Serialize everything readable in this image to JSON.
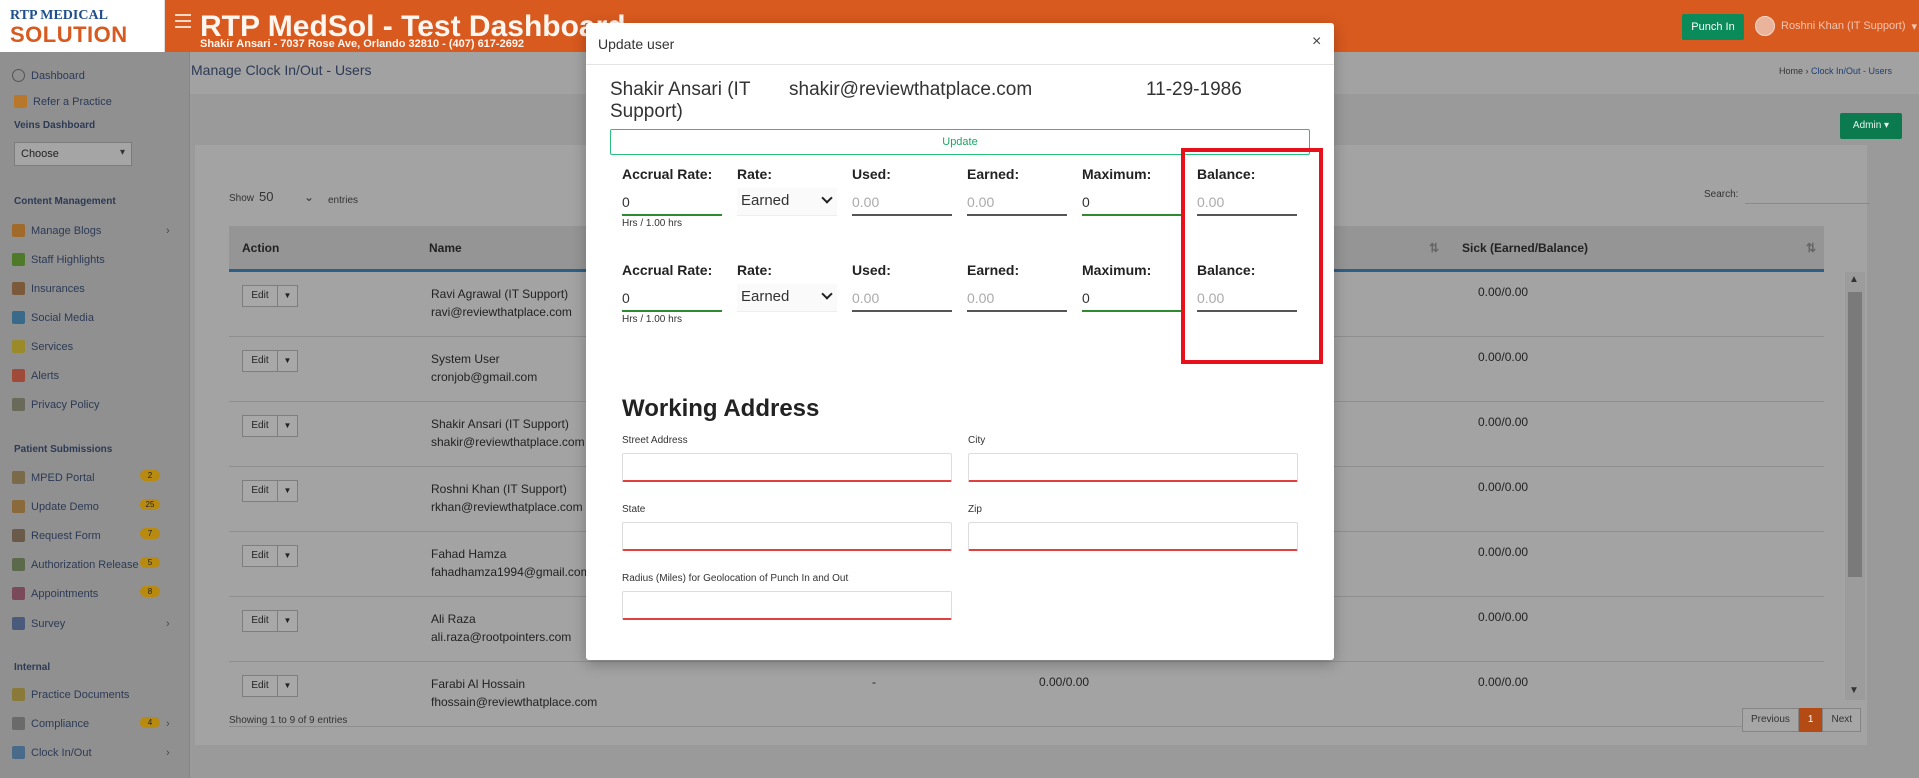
{
  "topbar": {
    "logo_line1": "RTP MEDICAL",
    "logo_line2": "SOLUTION",
    "title": "RTP MedSol - Test Dashboard",
    "subtitle": "Shakir Ansari - 7037 Rose Ave, Orlando 32810 - (407) 617-2692",
    "punch_in": "Punch In",
    "user": "Roshni Khan (IT Support)"
  },
  "sidebar": {
    "dashboard": "Dashboard",
    "refer": "Refer a Practice",
    "veins_dashboard": "Veins Dashboard",
    "choose": "Choose",
    "content_management": "Content Management",
    "manage_blogs": "Manage Blogs",
    "staff_highlights": "Staff Highlights",
    "insurances": "Insurances",
    "social_media": "Social Media",
    "services": "Services",
    "alerts": "Alerts",
    "privacy_policy": "Privacy Policy",
    "patient_submissions": "Patient Submissions",
    "mped_portal": "MPED Portal",
    "mped_badge": "2",
    "update_demo": "Update Demo",
    "update_demo_badge": "25",
    "request_form": "Request Form",
    "request_form_badge": "7",
    "auth_release": "Authorization Release",
    "auth_release_badge": "5",
    "appointments": "Appointments",
    "appointments_badge": "8",
    "survey": "Survey",
    "internal": "Internal",
    "practice_documents": "Practice Documents",
    "compliance": "Compliance",
    "compliance_badge": "4",
    "clock_in_out": "Clock In/Out"
  },
  "page": {
    "heading": "Manage Clock In/Out - Users",
    "breadcrumb_home": "Home",
    "breadcrumb_current": "Clock In/Out - Users",
    "admin": "Admin",
    "show": "Show",
    "show_value": "50",
    "entries": "entries",
    "search": "Search:",
    "showing": "Showing 1 to 9 of 9 entries",
    "prev": "Previous",
    "page_num": "1",
    "next": "Next"
  },
  "table": {
    "headers": {
      "action": "Action",
      "name": "Name",
      "sick": "Sick (Earned/Balance)"
    },
    "edit": "Edit",
    "rows": [
      {
        "name": "Ravi Agrawal (IT Support)",
        "email": "ravi@reviewthatplace.com",
        "sick": "0.00/0.00",
        "dash": "",
        "mid": ""
      },
      {
        "name": "System User",
        "email": "cronjob@gmail.com",
        "sick": "0.00/0.00",
        "dash": "",
        "mid": ""
      },
      {
        "name": "Shakir Ansari (IT Support)",
        "email": "shakir@reviewthatplace.com",
        "sick": "0.00/0.00",
        "dash": "",
        "mid": ""
      },
      {
        "name": "Roshni Khan (IT Support)",
        "email": "rkhan@reviewthatplace.com",
        "sick": "0.00/0.00",
        "dash": "",
        "mid": ""
      },
      {
        "name": "Fahad Hamza",
        "email": "fahadhamza1994@gmail.com",
        "sick": "0.00/0.00",
        "dash": "",
        "mid": ""
      },
      {
        "name": "Ali Raza",
        "email": "ali.raza@rootpointers.com",
        "sick": "0.00/0.00",
        "dash": "",
        "mid": ""
      },
      {
        "name": "Farabi Al Hossain",
        "email": "fhossain@reviewthatplace.com",
        "sick": "0.00/0.00",
        "dash": "-",
        "mid": "0.00/0.00"
      }
    ]
  },
  "modal": {
    "title": "Update user",
    "close": "×",
    "user_name": "Shakir Ansari (IT Support)",
    "user_email": "shakir@reviewthatplace.com",
    "user_dob": "11-29-1986",
    "update": "Update",
    "labels": {
      "accrual_rate": "Accrual Rate:",
      "rate": "Rate:",
      "used": "Used:",
      "earned": "Earned:",
      "maximum": "Maximum:",
      "balance": "Balance:"
    },
    "rows": [
      {
        "accrual_rate": "0",
        "hint": "Hrs / 1.00 hrs",
        "rate": "Earned",
        "used_placeholder": "0.00",
        "earned_placeholder": "0.00",
        "maximum": "0",
        "balance_placeholder": "0.00"
      },
      {
        "accrual_rate": "0",
        "hint": "Hrs / 1.00 hrs",
        "rate": "Earned",
        "used_placeholder": "0.00",
        "earned_placeholder": "0.00",
        "maximum": "0",
        "balance_placeholder": "0.00"
      }
    ],
    "working_address": {
      "heading": "Working Address",
      "street": "Street Address",
      "city": "City",
      "state": "State",
      "zip": "Zip",
      "radius": "Radius (Miles) for Geolocation of Punch In and Out"
    }
  },
  "colors": {
    "topbar": "#d85a1f",
    "punch_in": "#0b8a5a",
    "update_border": "#2bbf7e",
    "highlight": "#e8101a",
    "error_underline": "#e04040"
  }
}
